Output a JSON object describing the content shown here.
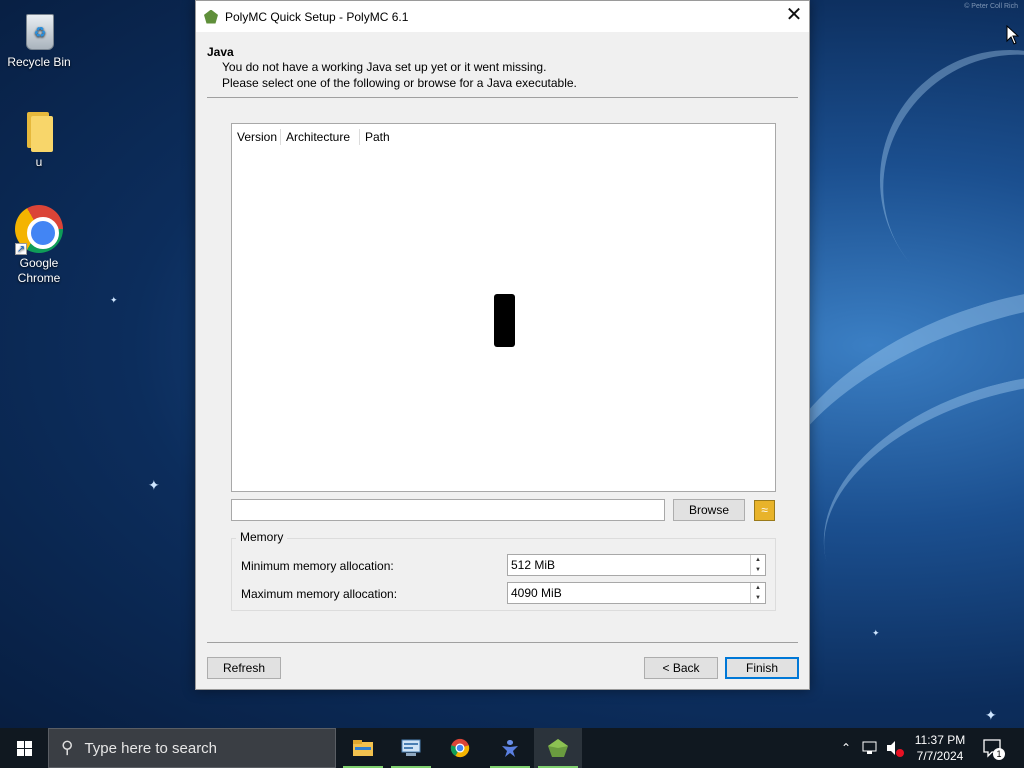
{
  "wallpaper": {
    "watermark": "© Peter Coll Rich"
  },
  "desktop": {
    "icons": [
      {
        "label": "Recycle Bin",
        "icon": "recycle-bin-icon"
      },
      {
        "label": "u",
        "icon": "folder-icon"
      },
      {
        "label": "Google Chrome",
        "icon": "chrome-icon"
      }
    ]
  },
  "dialog": {
    "title": "PolyMC Quick Setup - PolyMC 6.1",
    "close_glyph": "✕",
    "page_title": "Java",
    "page_subtitle_line1": "You do not have a working Java set up yet or it went missing.",
    "page_subtitle_line2": "Please select one of the following or browse for a Java executable.",
    "java_list": {
      "columns": [
        "Version",
        "Architecture",
        "Path"
      ],
      "rows": [],
      "loading": true
    },
    "java_path": {
      "value": ""
    },
    "browse_label": "Browse",
    "memory": {
      "group_title": "Memory",
      "min_label": "Minimum memory allocation:",
      "min_value": "512 MiB",
      "max_label": "Maximum memory allocation:",
      "max_value": "4090 MiB"
    },
    "buttons": {
      "refresh": "Refresh",
      "back": "< Back",
      "finish": "Finish"
    }
  },
  "taskbar": {
    "search_placeholder": "Type here to search",
    "apps": [
      {
        "name": "file-explorer",
        "running": true
      },
      {
        "name": "control-panel",
        "running": true
      },
      {
        "name": "chrome",
        "running": false
      },
      {
        "name": "genie",
        "running": true
      },
      {
        "name": "polymc",
        "running": true,
        "active": true
      }
    ],
    "clock_time": "11:37 PM",
    "clock_date": "7/7/2024",
    "notification_count": "1"
  },
  "colors": {
    "accent": "#0078d7",
    "taskbar": "#101820",
    "dialog_bg": "#f0f0f0",
    "running_indicator": "#7fd06f"
  }
}
